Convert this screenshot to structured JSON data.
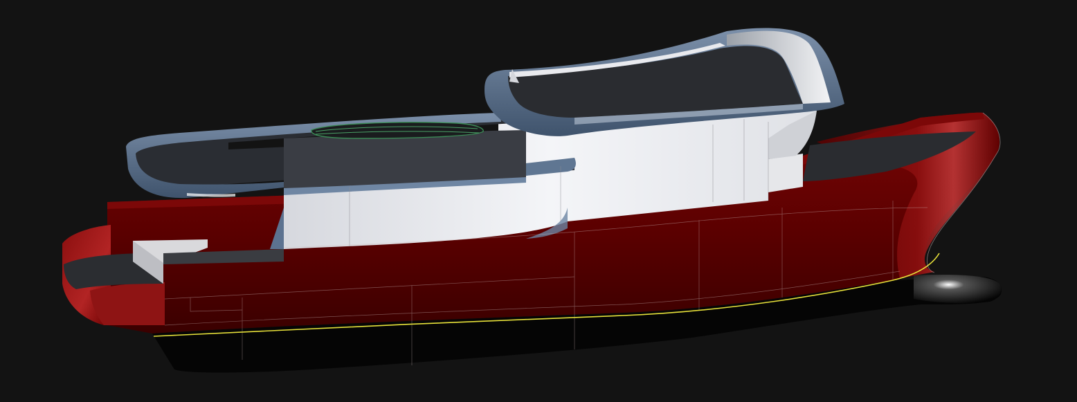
{
  "viewport": {
    "background": "#131313",
    "model": "vessel-3d-render"
  },
  "colors": {
    "hull_red": "#6e0000",
    "hull_red_dark": "#4a0000",
    "hull_red_light": "#a31414",
    "underwater_black": "#050505",
    "superstructure_white": "#eceef2",
    "trim_blue": "#5f7590",
    "glass_dark": "#2a2d33",
    "waterline_yellow": "#e8e23a",
    "edge_lines": "#c9b7b7"
  },
  "icons": {
    "tender": "boat-icon"
  }
}
